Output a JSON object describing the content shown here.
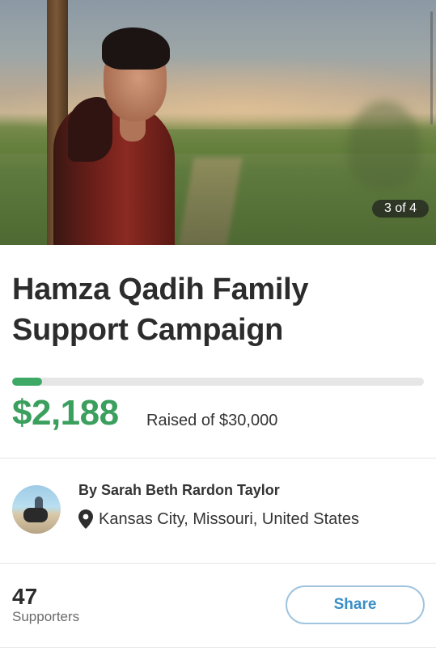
{
  "hero": {
    "image_counter": "3 of 4"
  },
  "campaign": {
    "title_line1": "Hamza Qadih Family",
    "title_line2": "Support Campaign",
    "amount_raised": "$2,188",
    "raised_of_text": "Raised of $30,000",
    "progress_fraction": 0.073,
    "progress_color": "#3da964"
  },
  "organizer": {
    "name": "By Sarah Beth Rardon Taylor",
    "location": "Kansas City, Missouri, United States",
    "location_icon": "map-pin-icon"
  },
  "supporters": {
    "count": "47",
    "label": "Supporters"
  },
  "actions": {
    "share_label": "Share"
  },
  "colors": {
    "accent_green": "#3b9f5e",
    "share_blue": "#3a8fc6"
  }
}
